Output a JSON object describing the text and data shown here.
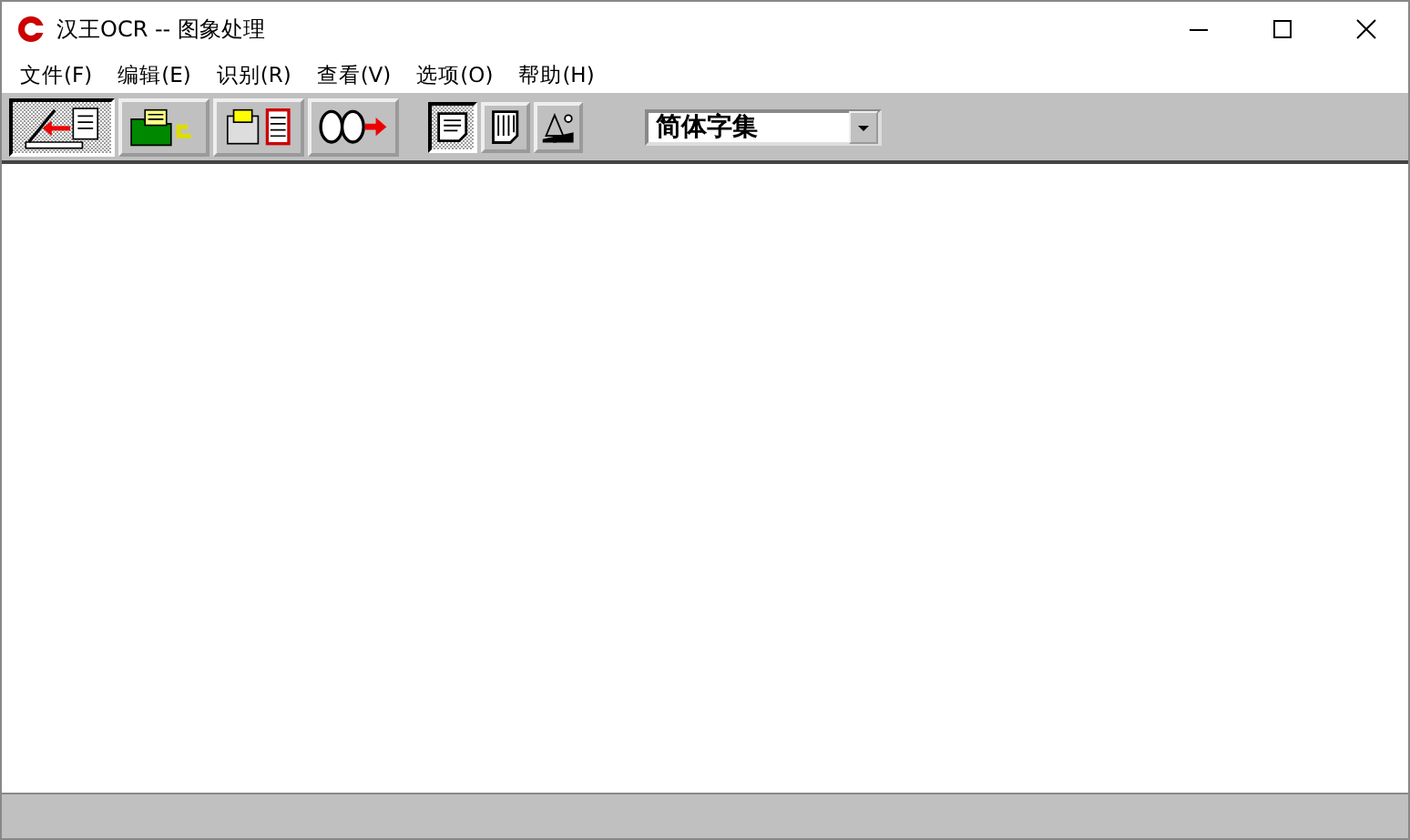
{
  "window": {
    "title": "汉王OCR -- 图象处理"
  },
  "menu": [
    {
      "label": "文件(F)"
    },
    {
      "label": "编辑(E)"
    },
    {
      "label": "识别(R)"
    },
    {
      "label": "查看(V)"
    },
    {
      "label": "选项(O)"
    },
    {
      "label": "帮助(H)"
    }
  ],
  "toolbar": [
    {
      "kind": "scan",
      "selected": true
    },
    {
      "kind": "open",
      "selected": false
    },
    {
      "kind": "recognize",
      "selected": false
    },
    {
      "kind": "next",
      "selected": false
    }
  ],
  "view_toggles": [
    {
      "kind": "text",
      "selected": true
    },
    {
      "kind": "columns",
      "selected": false
    },
    {
      "kind": "image",
      "selected": false
    }
  ],
  "charset": {
    "value": "简体字集"
  }
}
